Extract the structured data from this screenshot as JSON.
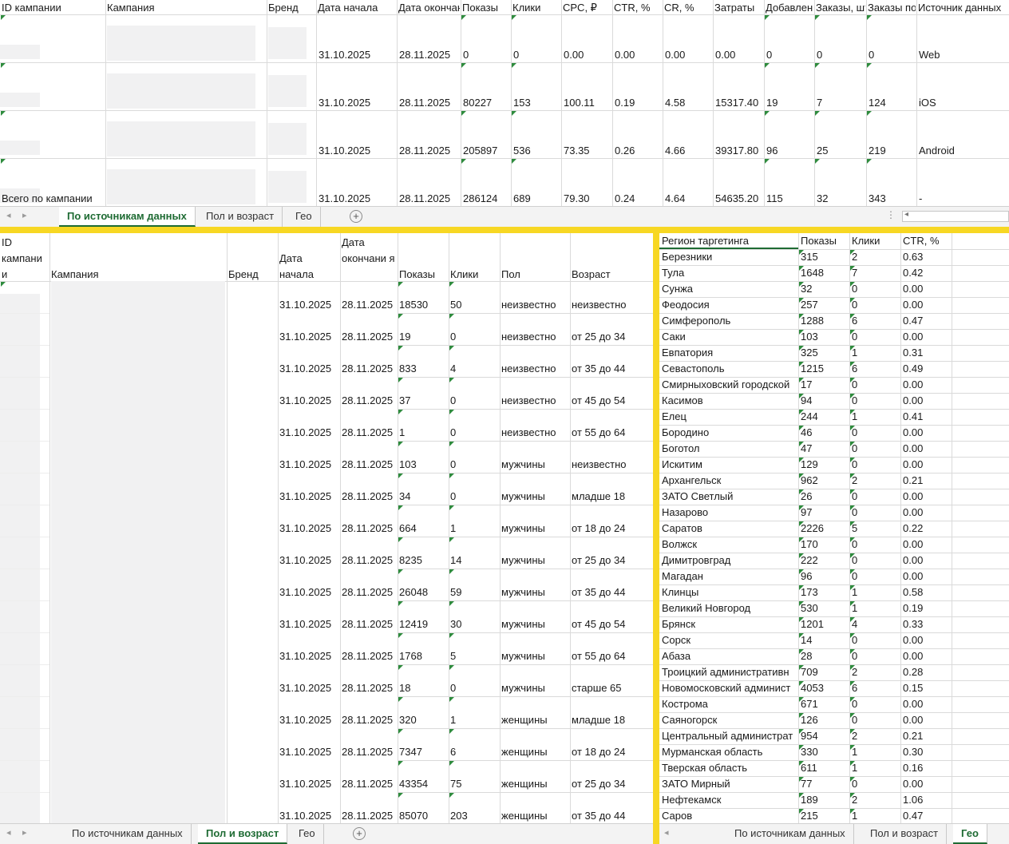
{
  "top": {
    "headers": [
      "ID кампании",
      "Кампания",
      "Бренд",
      "Дата начала",
      "Дата окончания",
      "Показы",
      "Клики",
      "CPC, ₽",
      "CTR, %",
      "CR, %",
      "Затраты",
      "Добавления",
      "Заказы, шт",
      "Заказы по",
      "Источник данных"
    ],
    "rows": [
      {
        "id": "",
        "start": "31.10.2025",
        "end": "28.11.2025",
        "shows": "0",
        "clicks": "0",
        "cpc": "0.00",
        "ctr": "0.00",
        "cr": "0.00",
        "cost": "0.00",
        "adds": "0",
        "orders": "0",
        "orders2": "0",
        "source": "Web"
      },
      {
        "id": "",
        "start": "31.10.2025",
        "end": "28.11.2025",
        "shows": "80227",
        "clicks": "153",
        "cpc": "100.11",
        "ctr": "0.19",
        "cr": "4.58",
        "cost": "15317.40",
        "adds": "19",
        "orders": "7",
        "orders2": "124",
        "source": "iOS"
      },
      {
        "id": "",
        "start": "31.10.2025",
        "end": "28.11.2025",
        "shows": "205897",
        "clicks": "536",
        "cpc": "73.35",
        "ctr": "0.26",
        "cr": "4.66",
        "cost": "39317.80",
        "adds": "96",
        "orders": "25",
        "orders2": "219",
        "source": "Android"
      },
      {
        "id": "Всего по кампании",
        "start": "31.10.2025",
        "end": "28.11.2025",
        "shows": "286124",
        "clicks": "689",
        "cpc": "79.30",
        "ctr": "0.24",
        "cr": "4.64",
        "cost": "54635.20",
        "adds": "115",
        "orders": "32",
        "orders2": "343",
        "source": "-"
      }
    ],
    "tabs": [
      "По источникам данных",
      "Пол и возраст",
      "Гео"
    ]
  },
  "mid": {
    "headers": {
      "id": "ID кампани и",
      "campaign": "Кампания",
      "brand": "Бренд",
      "start": "Дата начала",
      "end": "Дата окончани я",
      "shows": "Показы",
      "clicks": "Клики",
      "sex": "Пол",
      "age": "Возраст"
    },
    "rows": [
      {
        "start": "31.10.2025",
        "end": "28.11.2025",
        "shows": "18530",
        "clicks": "50",
        "sex": "неизвестно",
        "age": "неизвестно"
      },
      {
        "start": "31.10.2025",
        "end": "28.11.2025",
        "shows": "19",
        "clicks": "0",
        "sex": "неизвестно",
        "age": "от 25 до 34"
      },
      {
        "start": "31.10.2025",
        "end": "28.11.2025",
        "shows": "833",
        "clicks": "4",
        "sex": "неизвестно",
        "age": "от 35 до 44"
      },
      {
        "start": "31.10.2025",
        "end": "28.11.2025",
        "shows": "37",
        "clicks": "0",
        "sex": "неизвестно",
        "age": "от 45 до 54"
      },
      {
        "start": "31.10.2025",
        "end": "28.11.2025",
        "shows": "1",
        "clicks": "0",
        "sex": "неизвестно",
        "age": "от 55 до 64"
      },
      {
        "start": "31.10.2025",
        "end": "28.11.2025",
        "shows": "103",
        "clicks": "0",
        "sex": "мужчины",
        "age": "неизвестно"
      },
      {
        "start": "31.10.2025",
        "end": "28.11.2025",
        "shows": "34",
        "clicks": "0",
        "sex": "мужчины",
        "age": "младше 18"
      },
      {
        "start": "31.10.2025",
        "end": "28.11.2025",
        "shows": "664",
        "clicks": "1",
        "sex": "мужчины",
        "age": "от 18 до 24"
      },
      {
        "start": "31.10.2025",
        "end": "28.11.2025",
        "shows": "8235",
        "clicks": "14",
        "sex": "мужчины",
        "age": "от 25 до 34"
      },
      {
        "start": "31.10.2025",
        "end": "28.11.2025",
        "shows": "26048",
        "clicks": "59",
        "sex": "мужчины",
        "age": "от 35 до 44"
      },
      {
        "start": "31.10.2025",
        "end": "28.11.2025",
        "shows": "12419",
        "clicks": "30",
        "sex": "мужчины",
        "age": "от 45 до 54"
      },
      {
        "start": "31.10.2025",
        "end": "28.11.2025",
        "shows": "1768",
        "clicks": "5",
        "sex": "мужчины",
        "age": "от 55 до 64"
      },
      {
        "start": "31.10.2025",
        "end": "28.11.2025",
        "shows": "18",
        "clicks": "0",
        "sex": "мужчины",
        "age": "старше 65"
      },
      {
        "start": "31.10.2025",
        "end": "28.11.2025",
        "shows": "320",
        "clicks": "1",
        "sex": "женщины",
        "age": "младше 18"
      },
      {
        "start": "31.10.2025",
        "end": "28.11.2025",
        "shows": "7347",
        "clicks": "6",
        "sex": "женщины",
        "age": "от 18 до 24"
      },
      {
        "start": "31.10.2025",
        "end": "28.11.2025",
        "shows": "43354",
        "clicks": "75",
        "sex": "женщины",
        "age": "от 25 до 34"
      },
      {
        "start": "31.10.2025",
        "end": "28.11.2025",
        "shows": "85070",
        "clicks": "203",
        "sex": "женщины",
        "age": "от 35 до 44"
      }
    ],
    "tabs": [
      "По источникам данных",
      "Пол и возраст",
      "Гео"
    ]
  },
  "geo": {
    "headers": [
      "Регион таргетинга",
      "Показы",
      "Клики",
      "CTR, %"
    ],
    "rows": [
      [
        "Березники",
        "315",
        "2",
        "0.63"
      ],
      [
        "Тула",
        "1648",
        "7",
        "0.42"
      ],
      [
        "Сунжа",
        "32",
        "0",
        "0.00"
      ],
      [
        "Феодосия",
        "257",
        "0",
        "0.00"
      ],
      [
        "Симферополь",
        "1288",
        "6",
        "0.47"
      ],
      [
        "Саки",
        "103",
        "0",
        "0.00"
      ],
      [
        "Евпатория",
        "325",
        "1",
        "0.31"
      ],
      [
        "Севастополь",
        "1215",
        "6",
        "0.49"
      ],
      [
        "Смирныховский городской",
        "17",
        "0",
        "0.00"
      ],
      [
        "Касимов",
        "94",
        "0",
        "0.00"
      ],
      [
        "Елец",
        "244",
        "1",
        "0.41"
      ],
      [
        "Бородино",
        "46",
        "0",
        "0.00"
      ],
      [
        "Боготол",
        "47",
        "0",
        "0.00"
      ],
      [
        "Искитим",
        "129",
        "0",
        "0.00"
      ],
      [
        "Архангельск",
        "962",
        "2",
        "0.21"
      ],
      [
        "ЗАТО Светлый",
        "26",
        "0",
        "0.00"
      ],
      [
        "Назарово",
        "97",
        "0",
        "0.00"
      ],
      [
        "Саратов",
        "2226",
        "5",
        "0.22"
      ],
      [
        "Волжск",
        "170",
        "0",
        "0.00"
      ],
      [
        "Димитровград",
        "222",
        "0",
        "0.00"
      ],
      [
        "Магадан",
        "96",
        "0",
        "0.00"
      ],
      [
        "Клинцы",
        "173",
        "1",
        "0.58"
      ],
      [
        "Великий Новгород",
        "530",
        "1",
        "0.19"
      ],
      [
        "Брянск",
        "1201",
        "4",
        "0.33"
      ],
      [
        "Сорск",
        "14",
        "0",
        "0.00"
      ],
      [
        "Абаза",
        "28",
        "0",
        "0.00"
      ],
      [
        "Троицкий административн",
        "709",
        "2",
        "0.28"
      ],
      [
        "Новомосковский админист",
        "4053",
        "6",
        "0.15"
      ],
      [
        "Кострома",
        "671",
        "0",
        "0.00"
      ],
      [
        "Саяногорск",
        "126",
        "0",
        "0.00"
      ],
      [
        "Центральный администрат",
        "954",
        "2",
        "0.21"
      ],
      [
        "Мурманская область",
        "330",
        "1",
        "0.30"
      ],
      [
        "Тверская область",
        "611",
        "1",
        "0.16"
      ],
      [
        "ЗАТО Мирный",
        "77",
        "0",
        "0.00"
      ],
      [
        "Нефтекамск",
        "189",
        "2",
        "1.06"
      ],
      [
        "Саров",
        "215",
        "1",
        "0.47"
      ]
    ],
    "tabs": [
      "По источникам данных",
      "Пол и возраст",
      "Гео"
    ]
  }
}
